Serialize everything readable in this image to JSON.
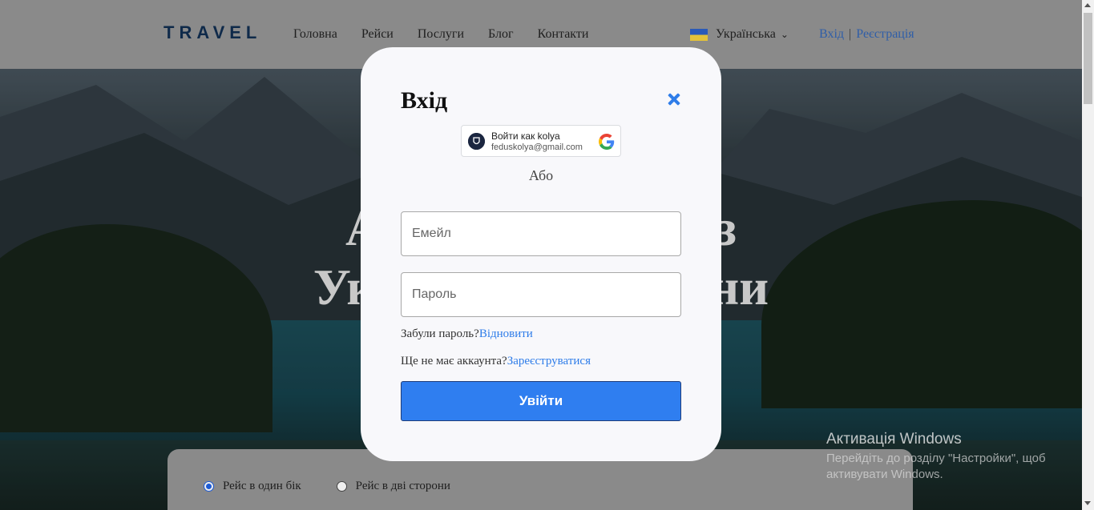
{
  "header": {
    "logo": "TRAVEL",
    "nav": [
      "Головна",
      "Рейси",
      "Послуги",
      "Блог",
      "Контакти"
    ],
    "language": "Українська",
    "login_link": "Вхід",
    "separator": "|",
    "register_link": "Реєстрація"
  },
  "hero": {
    "line1": "А                          з",
    "line2": "Ук                          ни"
  },
  "booking": {
    "options": [
      {
        "label": "Рейс в один бік",
        "selected": true
      },
      {
        "label": "Рейс в дві сторони",
        "selected": false
      }
    ]
  },
  "modal": {
    "title": "Вхід",
    "google": {
      "account_label": "Войти как kolya",
      "email": "feduskolya@gmail.com"
    },
    "or_text": "Або",
    "email_placeholder": "Емейл",
    "password_placeholder": "Пароль",
    "forgot_text": "Забули пароль?",
    "forgot_link": "Відновити",
    "noacc_text": "Ще не має аккаунта?",
    "register_link": "Зареєструватися",
    "submit_label": "Увійти"
  },
  "watermark": {
    "title": "Активація Windows",
    "subtitle": "Перейдіть до розділу \"Настройки\", щоб активувати Windows."
  },
  "colors": {
    "accent": "#2f7ef0",
    "link": "#2f7de9",
    "logo": "#0f2a4a"
  }
}
